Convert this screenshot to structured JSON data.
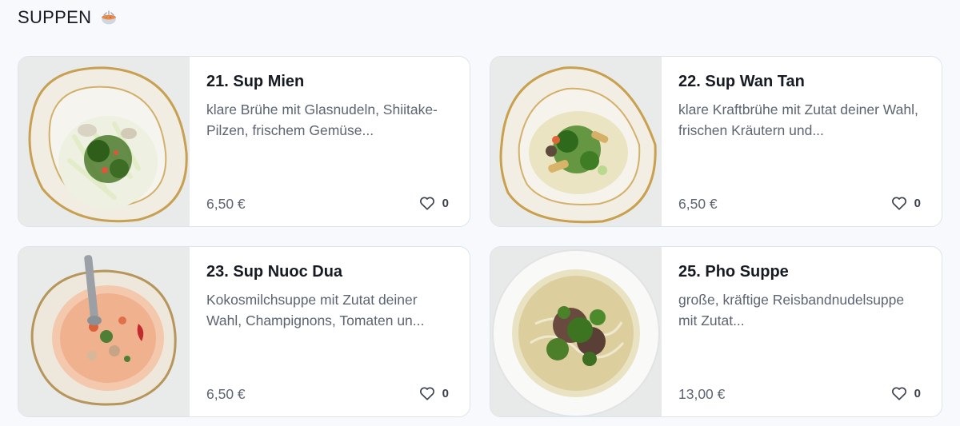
{
  "section": {
    "title": "SUPPEN",
    "icon": "soup-bowl-emoji"
  },
  "items": [
    {
      "name": "21. Sup Mien",
      "description": "klare Brühe mit Glasnudeln, Shiitake-Pilzen, frischem Gemüse...",
      "price": "6,50 €",
      "likes": "0",
      "image": "clear-noodle-soup"
    },
    {
      "name": "22. Sup Wan Tan",
      "description": "klare Kraftbrühe mit Zutat deiner Wahl, frischen Kräutern und...",
      "price": "6,50 €",
      "likes": "0",
      "image": "wonton-soup"
    },
    {
      "name": "23. Sup Nuoc Dua",
      "description": "Kokosmilchsuppe mit Zutat deiner Wahl, Champignons, Tomaten un...",
      "price": "6,50 €",
      "likes": "0",
      "image": "coconut-soup"
    },
    {
      "name": "25. Pho Suppe",
      "description": "große, kräftige Reisbandnudelsuppe mit Zutat...",
      "price": "13,00 €",
      "likes": "0",
      "image": "pho-soup"
    }
  ],
  "colors": {
    "border": "#dbe4ee",
    "text": "#161a22",
    "muted": "#5d6472",
    "background": "#f7f9fc"
  }
}
